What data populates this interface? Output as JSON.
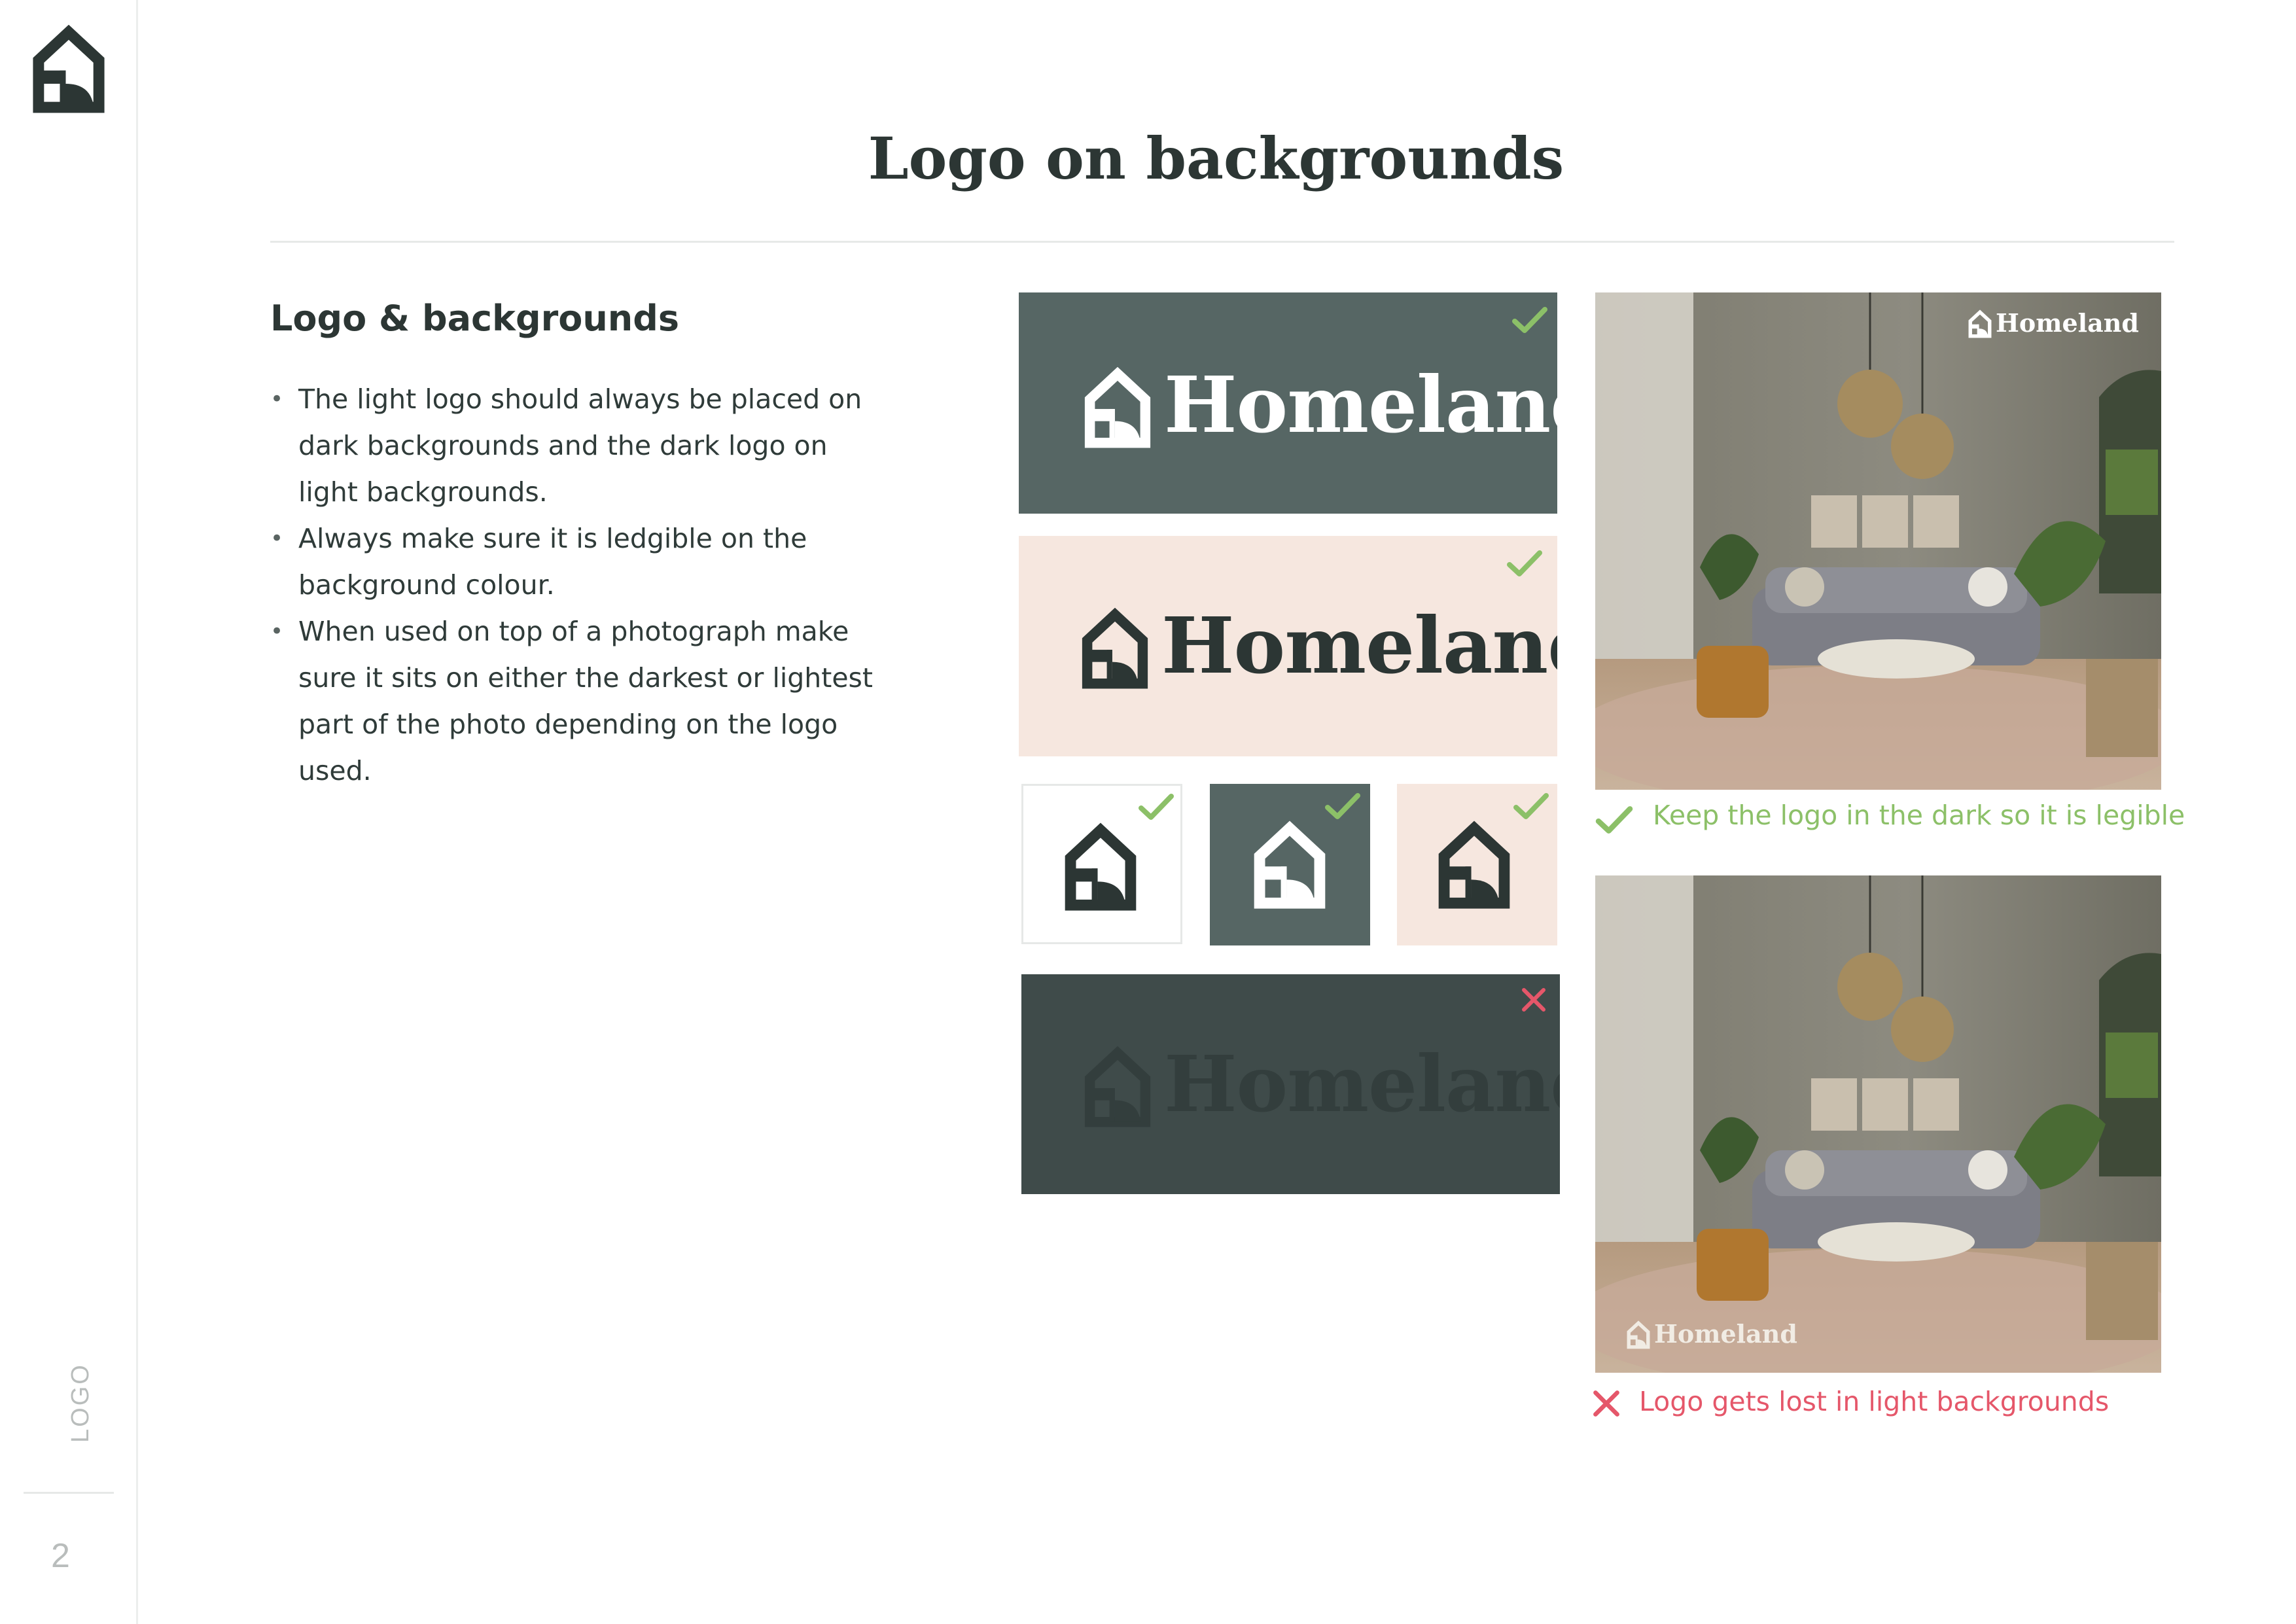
{
  "sidebar": {
    "section_label": "LOGO",
    "page_number": "2"
  },
  "page_title": "Logo on backgrounds",
  "content": {
    "subheading": "Logo & backgrounds",
    "bullets": [
      "The light logo should always be placed on dark backgrounds and the dark logo on light backgrounds.",
      "Always make sure it is ledgible on the background colour.",
      "When used on top of a photograph make sure it sits on either the darkest or lightest part of the photo depending on the logo used."
    ]
  },
  "brand": {
    "wordmark": "Homeland"
  },
  "examples": {
    "photo_good_caption": "Keep the logo in the dark so it is legible",
    "photo_bad_caption": "Logo gets lost in light backgrounds"
  },
  "colors": {
    "dark_slate": "#566664",
    "darker_slate": "#3f4b4a",
    "blush": "#f6e7df",
    "ink": "#2c3634",
    "approve_green": "#8cc068",
    "reject_red": "#e5576a"
  },
  "icons": [
    "house-logo-icon",
    "check-icon",
    "cross-icon"
  ]
}
